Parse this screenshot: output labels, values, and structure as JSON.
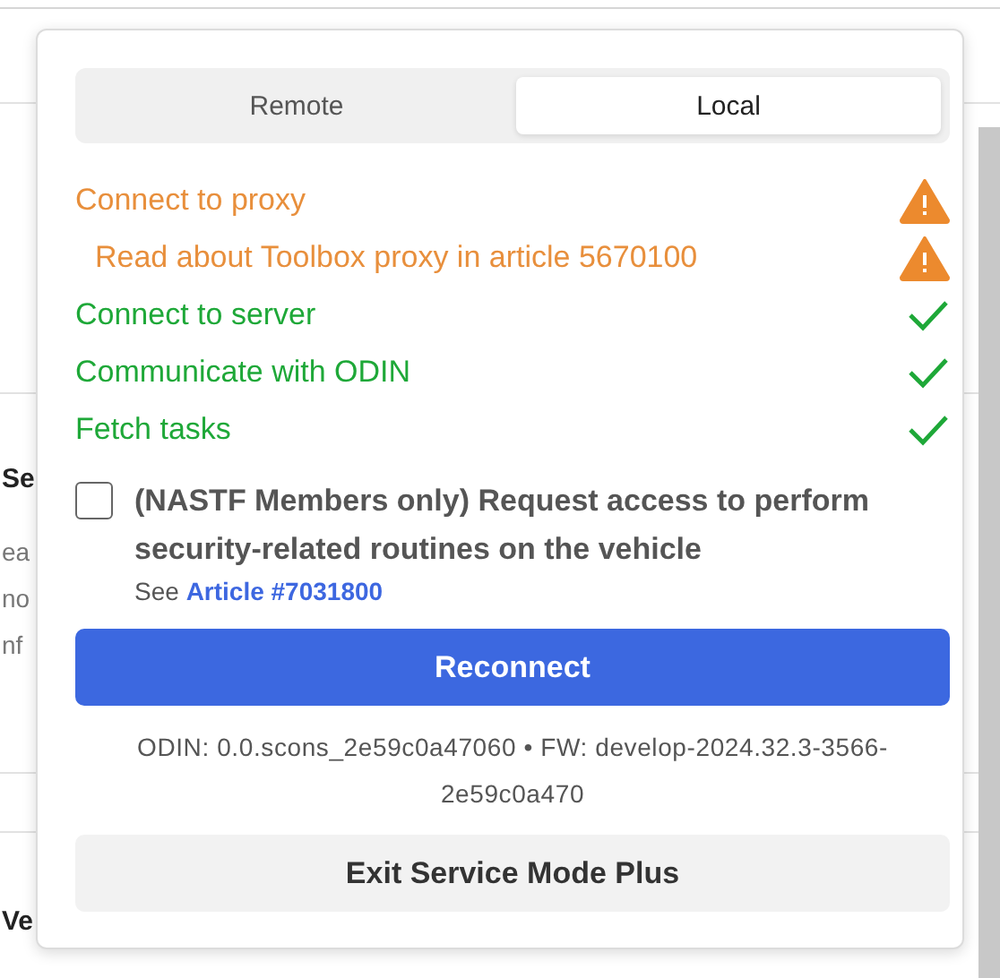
{
  "background": {
    "texts": [
      {
        "text": "Se",
        "kind": "heading"
      },
      {
        "text": "ea",
        "kind": "body"
      },
      {
        "text": "no",
        "kind": "body"
      },
      {
        "text": "nf",
        "kind": "body"
      },
      {
        "text": "Ve",
        "kind": "heading"
      }
    ]
  },
  "popup": {
    "tabs": [
      {
        "label": "Remote",
        "selected": false
      },
      {
        "label": "Local",
        "selected": true
      }
    ],
    "steps": [
      {
        "label": "Connect to proxy",
        "kind": "warning",
        "indent": false
      },
      {
        "label": "Read about Toolbox proxy in article 5670100",
        "kind": "warning",
        "indent": true
      },
      {
        "label": "Connect to server",
        "kind": "ok",
        "indent": false
      },
      {
        "label": "Communicate with ODIN",
        "kind": "ok",
        "indent": false
      },
      {
        "label": "Fetch tasks",
        "kind": "ok",
        "indent": false
      }
    ],
    "consent": {
      "label": "(NASTF Members only) Request access to perform security-related routines on the vehicle",
      "checked": false,
      "see": "See",
      "link": "Article #7031800"
    },
    "reconnect": "Reconnect",
    "version": "ODIN: 0.0.scons_2e59c0a47060 • FW: develop-2024.32.3-3566-2e59c0a470",
    "exit": "Exit Service Mode Plus"
  }
}
